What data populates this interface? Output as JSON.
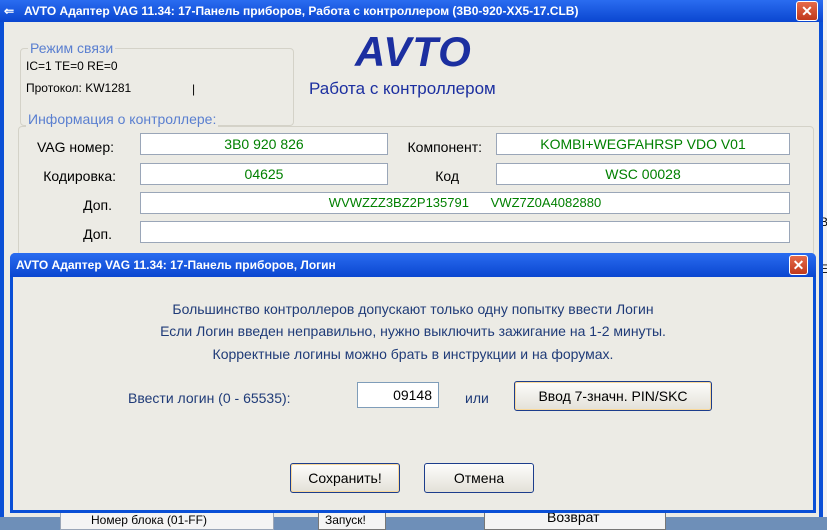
{
  "main_window": {
    "title": "AVTO Адаптер VAG 11.34: 17-Панель приборов,  Работа с контроллером (3B0-920-XX5-17.CLB)",
    "close_glyph": "✕",
    "sys_icon_glyph": "⇐",
    "connection": {
      "label": "Режим связи",
      "ic_te_re": "IC=1  TE=0  RE=0",
      "protocol": "Протокол: KW1281",
      "cursor_mark": "|"
    },
    "logo": "AVTO",
    "subtitle": "Работа с контроллером",
    "info_group_label": "Информация о контроллере:",
    "fields": {
      "vag_label": "VAG номер:",
      "vag_value": "3B0 920 826",
      "component_label": "Компонент:",
      "component_value": "KOMBI+WEGFAHRSP VDO V01",
      "coding_label": "Кодировка:",
      "coding_value": "04625",
      "code_label": "Код",
      "code_value": "WSC 00028",
      "extra1_label": "Доп.",
      "extra1_value": "WVWZZZ3BZ2P135791      VWZ7Z0A4082880",
      "extra2_label": "Доп.",
      "extra2_value": ""
    },
    "bottom_row": {
      "left_text": "Номер блока (01-FF)",
      "mid_text": "Запуск!",
      "right_text": "Возврат"
    }
  },
  "edge_window": {
    "labels": [
      "В",
      "Е"
    ]
  },
  "dialog": {
    "title": "AVTO Адаптер VAG 11.34: 17-Панель приборов,  Логин",
    "close_glyph": "✕",
    "lines": [
      "Большинство контроллеров допускают только одну попытку ввести Логин",
      "Если Логин введен неправильно, нужно выключить зажигание на 1-2 минуты.",
      "Корректные логины можно брать в инструкции и на форумах."
    ],
    "login_label": "Ввести логин (0 - 65535):",
    "login_value": "09148",
    "or_label": "или",
    "pin_button": "Ввод 7-значн. PIN/SKC",
    "save_button": "Сохранить!",
    "cancel_button": "Отмена"
  }
}
